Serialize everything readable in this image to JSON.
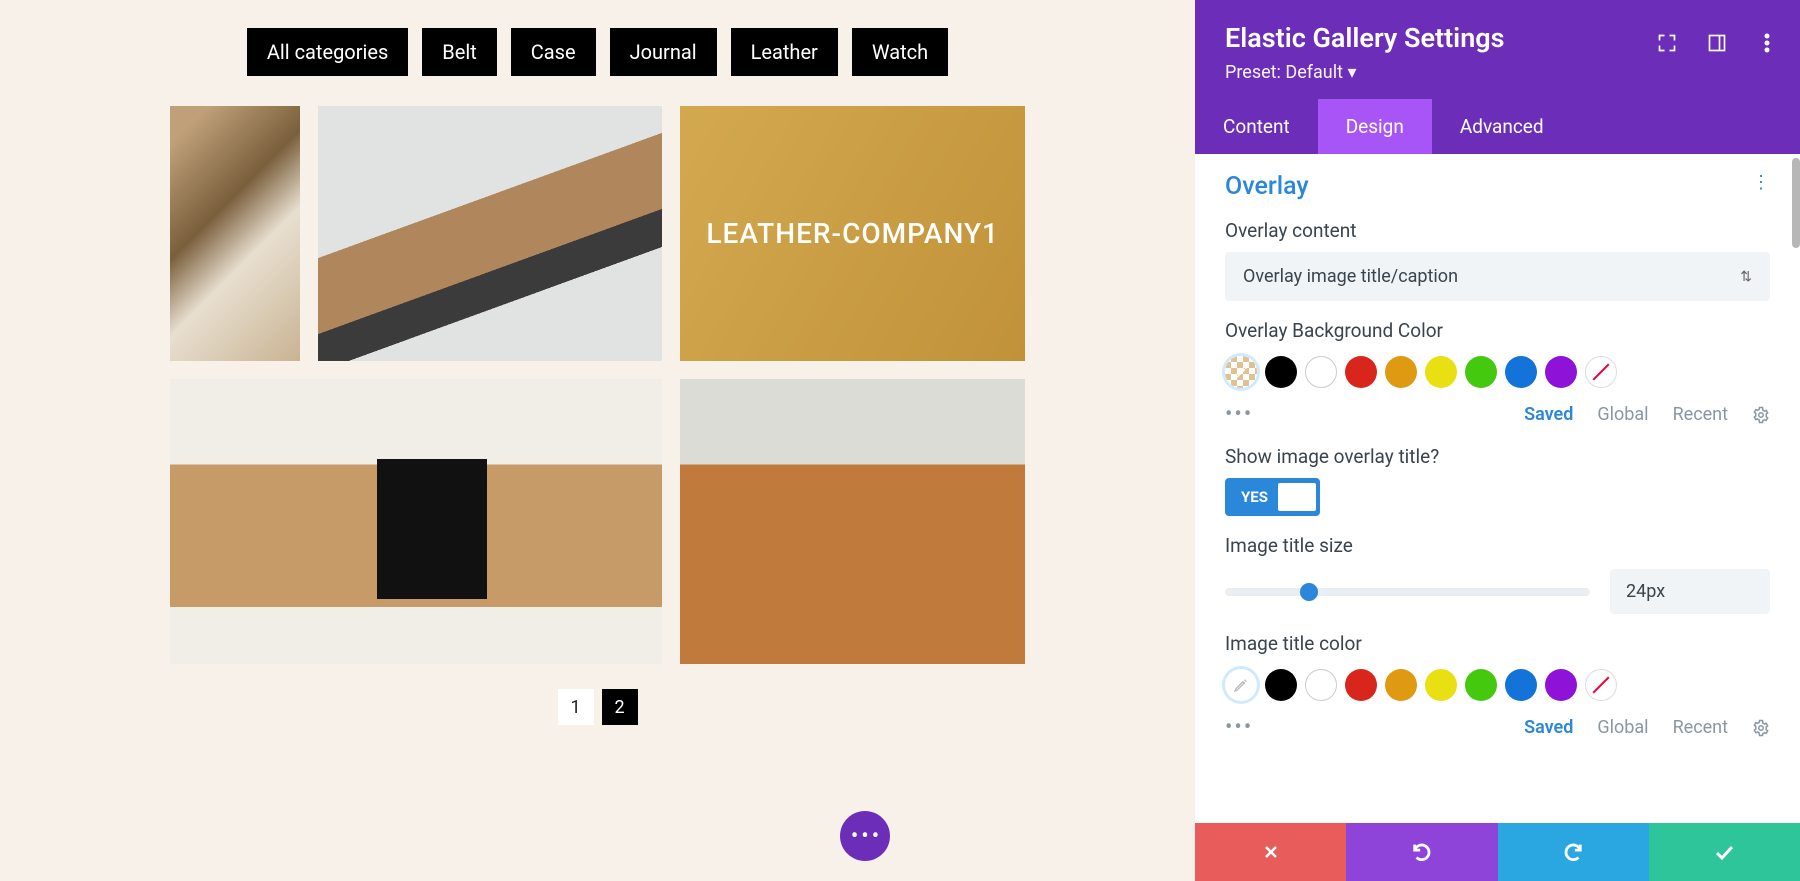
{
  "filters": [
    "All categories",
    "Belt",
    "Case",
    "Journal",
    "Leather",
    "Watch"
  ],
  "overlay_caption": "LEATHER-COMPANY1",
  "pagination": {
    "current": "1",
    "other": "2"
  },
  "panel": {
    "title": "Elastic Gallery Settings",
    "preset": "Preset: Default ▾",
    "tabs": {
      "content": "Content",
      "design": "Design",
      "advanced": "Advanced"
    },
    "section": "Overlay",
    "overlay_content_label": "Overlay content",
    "overlay_content_value": "Overlay image title/caption",
    "overlay_bg_label": "Overlay Background Color",
    "palette_tabs": {
      "saved": "Saved",
      "global": "Global",
      "recent": "Recent"
    },
    "show_title_label": "Show image overlay title?",
    "toggle_yes": "YES",
    "title_size_label": "Image title size",
    "title_size_value": "24px",
    "title_color_label": "Image title color"
  },
  "swatches": [
    "#000000",
    "#ffffff",
    "#d9261c",
    "#e09a12",
    "#e8e012",
    "#44c90e",
    "#1373d9",
    "#8e12d8"
  ]
}
